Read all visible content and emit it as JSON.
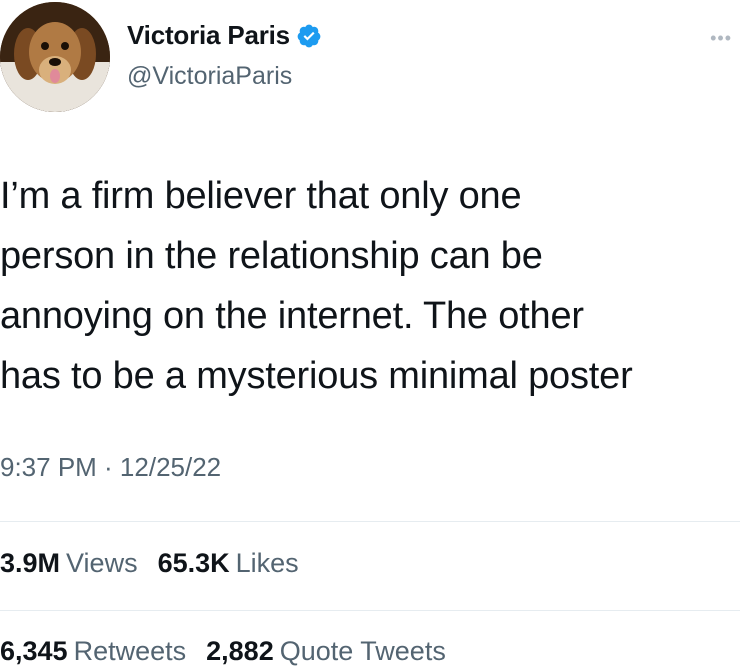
{
  "author": {
    "display_name": "Victoria Paris",
    "handle": "@VictoriaParis",
    "verified": true,
    "avatar_icon": "dog-avatar"
  },
  "tweet": {
    "text": "I’m a firm believer that only one\nperson in the relationship can be\nannoying on the internet. The other\nhas to be a mysterious minimal poster",
    "timestamp": "9:37 PM · 12/25/22"
  },
  "stats": {
    "views_count": "3.9M",
    "views_label": "Views",
    "likes_count": "65.3K",
    "likes_label": "Likes",
    "retweets_count": "6,345",
    "retweets_label": "Retweets",
    "quotes_count": "2,882",
    "quotes_label": "Quote Tweets"
  },
  "colors": {
    "verified": "#1d9bf0",
    "secondary_text": "#536471",
    "divider": "#e6ecf0"
  },
  "icons": {
    "more": "more-options-icon",
    "verified": "verified-badge-icon"
  }
}
